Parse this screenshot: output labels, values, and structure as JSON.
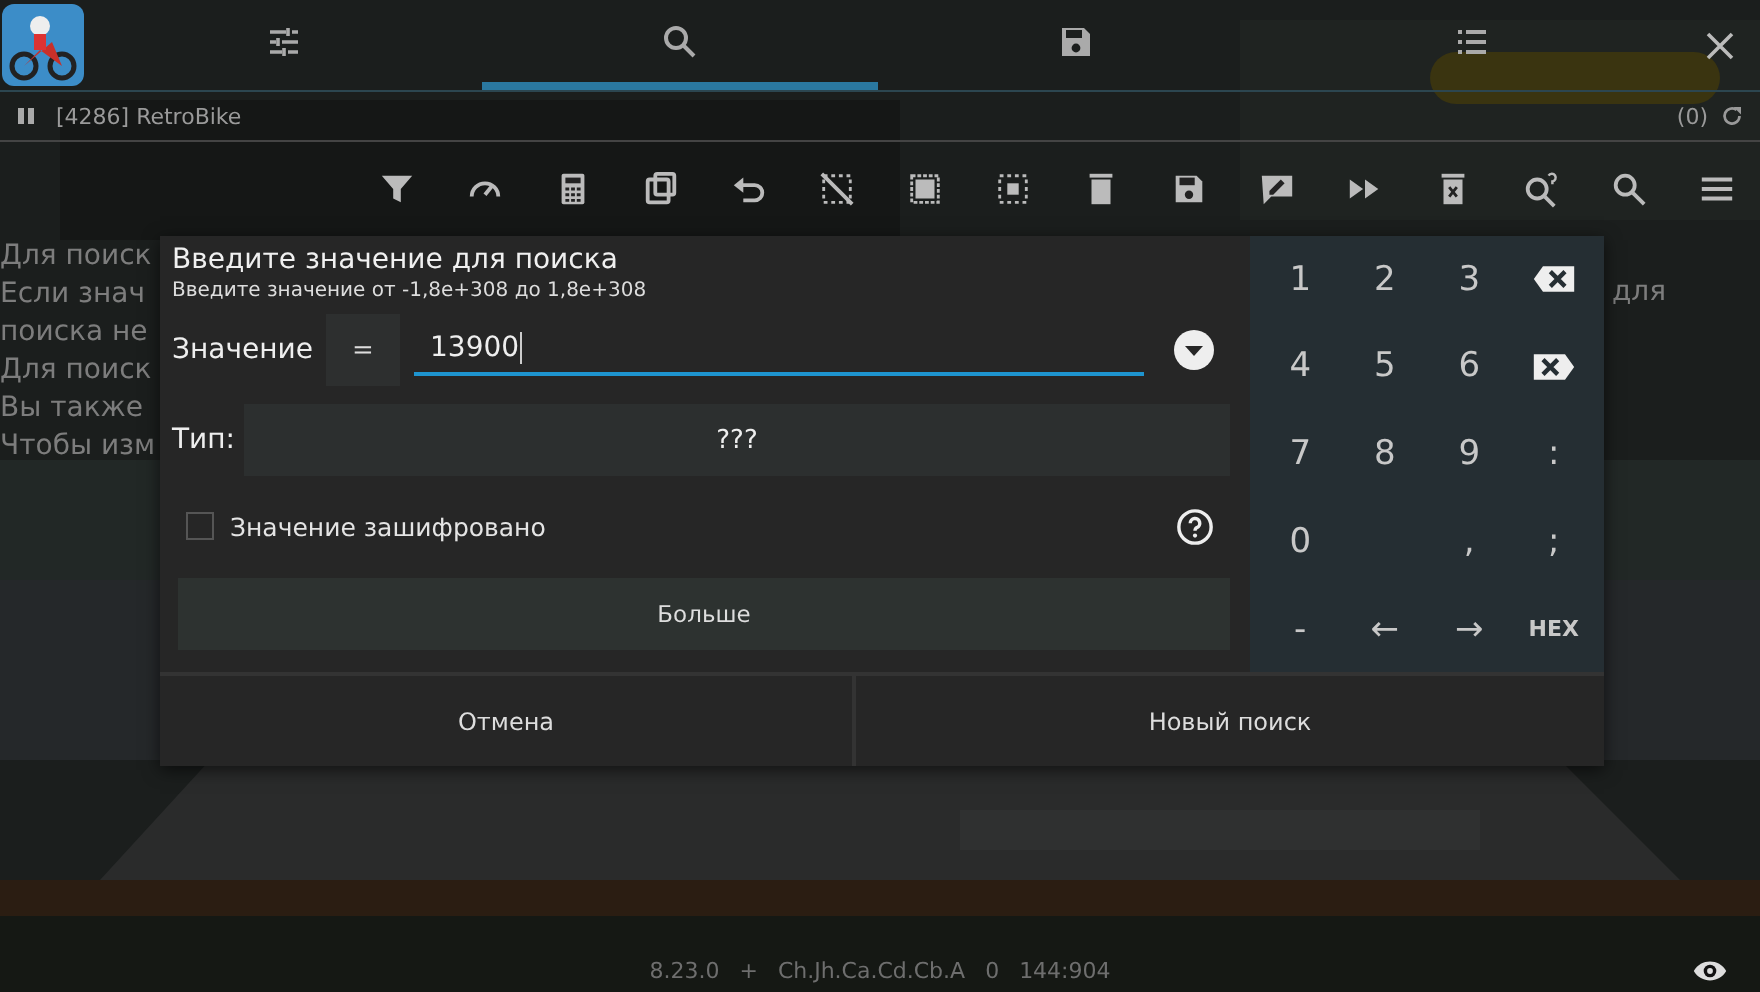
{
  "top_tabs": [
    {
      "kind": "settings",
      "selected": false
    },
    {
      "kind": "search",
      "selected": true
    },
    {
      "kind": "save",
      "selected": false
    },
    {
      "kind": "list",
      "selected": false
    }
  ],
  "process": {
    "label": "[4286] RetroBike",
    "count": "(0)"
  },
  "help_lines": [
    "Для поиск",
    "Если знач",
    "поиска не",
    "Для поиск",
    "Вы также",
    "Чтобы изм"
  ],
  "help_right": "для",
  "dialog": {
    "title": "Введите значение для поиска",
    "subtitle": "Введите значение от -1,8e+308 до 1,8e+308",
    "value_label": "Значение",
    "operator": "=",
    "value": "13900",
    "type_label": "Тип:",
    "type_value": "???",
    "encrypted": {
      "label": "Значение зашифровано",
      "checked": false
    },
    "more_button": "Больше",
    "buttons": [
      "Отмена",
      "Новый поиск"
    ],
    "keypad": [
      {
        "kind": "char",
        "label": "1"
      },
      {
        "kind": "char",
        "label": "2"
      },
      {
        "kind": "char",
        "label": "3"
      },
      {
        "kind": "backspace"
      },
      {
        "kind": "char",
        "label": "4"
      },
      {
        "kind": "char",
        "label": "5"
      },
      {
        "kind": "char",
        "label": "6"
      },
      {
        "kind": "delete"
      },
      {
        "kind": "char",
        "label": "7"
      },
      {
        "kind": "char",
        "label": "8"
      },
      {
        "kind": "char",
        "label": "9"
      },
      {
        "kind": "char",
        "label": ":"
      },
      {
        "kind": "char",
        "label": "0"
      },
      {
        "kind": "blank"
      },
      {
        "kind": "char",
        "label": ","
      },
      {
        "kind": "char",
        "label": ";"
      },
      {
        "kind": "char",
        "label": "-"
      },
      {
        "kind": "char",
        "label": "←"
      },
      {
        "kind": "char",
        "label": "→"
      },
      {
        "kind": "bold",
        "label": "HEX"
      }
    ]
  },
  "footer": [
    "8.23.0",
    "+",
    "Ch.Jh.Ca.Cd.Cb.A",
    "0",
    "144:904"
  ]
}
